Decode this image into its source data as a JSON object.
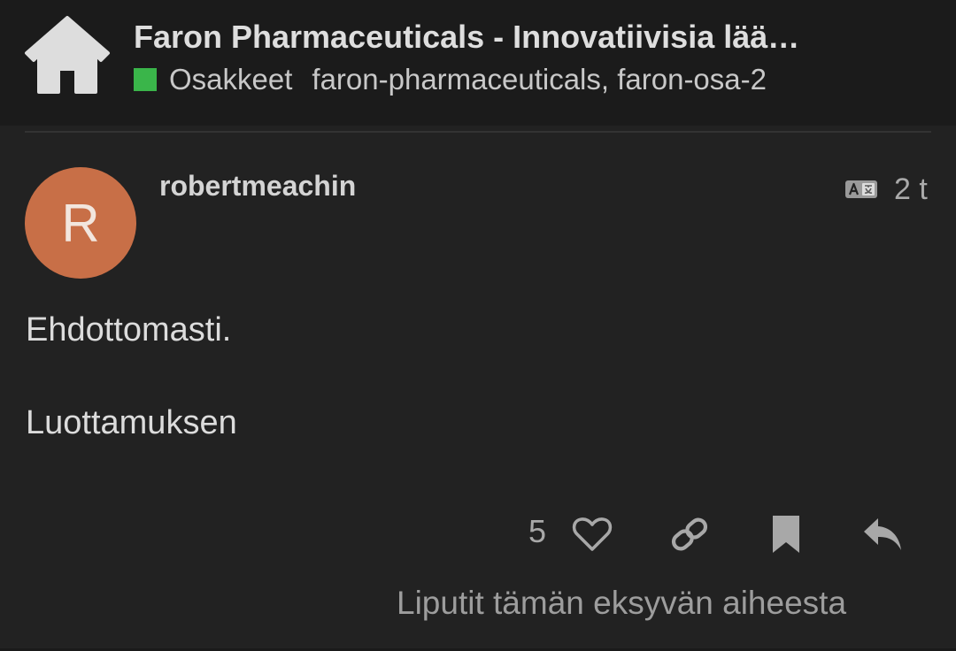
{
  "header": {
    "home_icon": "home-icon",
    "topic_title": "Faron Pharmaceuticals - Innovatiivisia lää…",
    "category": {
      "name": "Osakkeet",
      "color": "#3ab54a"
    },
    "tags": "faron-pharmaceuticals, faron-osa-2"
  },
  "post": {
    "avatar": {
      "letter": "R",
      "color": "#c86f47"
    },
    "username": "robertmeachin",
    "translate_icon": "translate-icon",
    "age": "2 t",
    "body": [
      "Ehdottomasti.",
      "Luottamuksen"
    ],
    "actions": {
      "like_count": "5",
      "icons": [
        "heart-icon",
        "link-icon",
        "bookmark-icon",
        "reply-icon"
      ]
    },
    "flag_notice": "Liputit tämän eksyvän aiheesta"
  }
}
